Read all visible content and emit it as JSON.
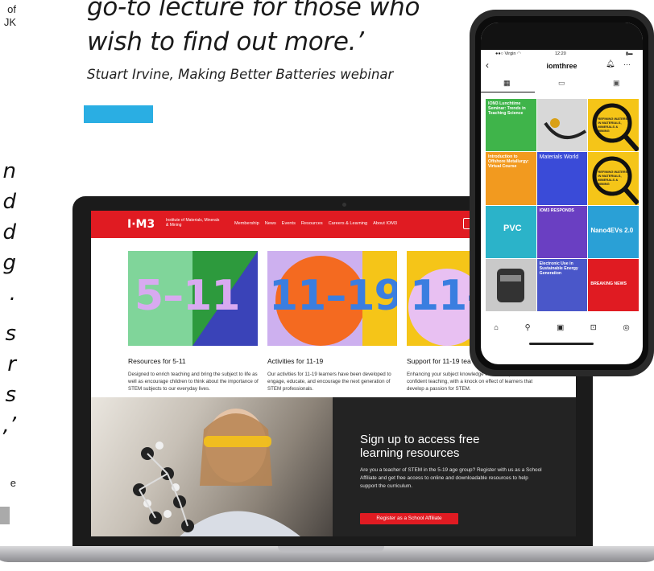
{
  "quote": {
    "line1": "go-to lecture for those who",
    "line2": "wish to find out more.’",
    "attribution": "Stuart Irvine, Making Better Batteries webinar"
  },
  "left_fragments": {
    "top1": "of",
    "top2": "JK",
    "lines": [
      "n",
      "d",
      "d",
      "g",
      ".",
      "s",
      "r",
      "s",
      ",’"
    ],
    "bottom": "e"
  },
  "website": {
    "logo": "I·M3",
    "logo_sub": "Institute of Materials, Minerals & Mining",
    "nav": [
      "Membership",
      "News",
      "Events",
      "Resources",
      "Careers & Learning",
      "About IOM3"
    ],
    "join": "Join",
    "cards": [
      {
        "number": "5–11",
        "title": "Resources for 5-11",
        "desc": "Designed to enrich teaching and bring the subject to life as well as encourage children to think about the importance of STEM subjects to our everyday lives."
      },
      {
        "number": "11–19",
        "title": "Activities for 11-19",
        "desc": "Our activities for 11-19 learners have been developed to engage, educate, and encourage the next generation of STEM professionals."
      },
      {
        "number": "11–",
        "title": "Support for 11-19 tea",
        "desc": "Enhancing your subject knowledge in order to promote more confident teaching, with a knock on effect of learners that develop a passion for STEM."
      }
    ],
    "promo": {
      "title": "Sign up to access free learning resources",
      "text": "Are you a teacher of STEM in the 5-19 age group? Register with us as a School Affiliate and get free access to online and downloadable resources to help support the curriculum.",
      "button": "Register as a School Affiliate"
    }
  },
  "phone": {
    "carrier": "Virgin",
    "time": "12:20",
    "account": "iomthree",
    "tiles": [
      {
        "text": "IOM3 Lunchtime Seminar: Trends in Teaching Science",
        "bg": "#3fb44a"
      },
      {
        "text": "",
        "bg": "#d8d8d8"
      },
      {
        "text": "REFINING WATERS IN MATERIALS, MINERALS & MINING",
        "bg": "#f5c518"
      },
      {
        "text": "Introduction to Offshore Metallurgy: Virtual Course",
        "bg": "#f29a1f"
      },
      {
        "text": "Materials World",
        "bg": "#3a4bd8"
      },
      {
        "text": "REFINING WATERS IN MATERIALS, MINERALS & MINING",
        "bg": "#f5c518"
      },
      {
        "text": "PVC",
        "bg": "#2bb3c9"
      },
      {
        "text": "IOM3 RESPONDS",
        "bg": "#6a3fc2"
      },
      {
        "text": "Nano4EVs 2.0",
        "bg": "#2aa0d6"
      },
      {
        "text": "",
        "bg": "#c9c9c9"
      },
      {
        "text": "Electronic Use in Sustainable Energy Generation",
        "bg": "#4a57c9"
      },
      {
        "text": "BREAKING NEWS",
        "bg": "#e01b22"
      }
    ]
  }
}
